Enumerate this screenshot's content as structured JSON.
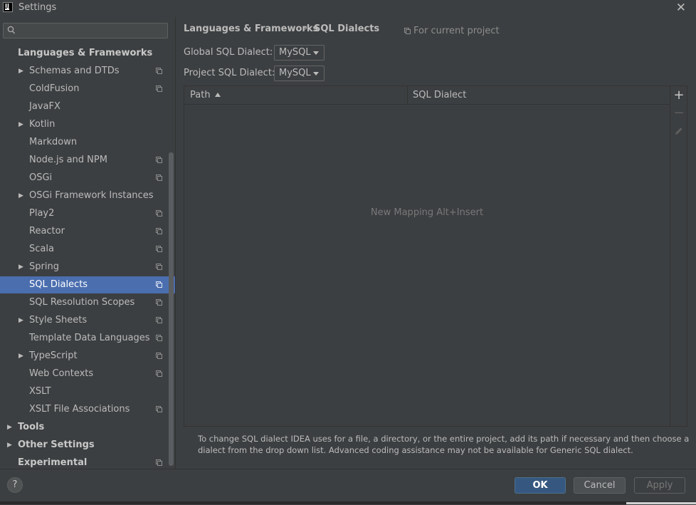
{
  "window": {
    "title": "Settings",
    "close_glyph": "✕",
    "logo_text": "IJ"
  },
  "sidebar": {
    "search_placeholder": "",
    "items": [
      {
        "label": "Languages & Frameworks",
        "level": 0,
        "bold": true,
        "arrow": false,
        "project_icon": false,
        "selected": false
      },
      {
        "label": "Schemas and DTDs",
        "level": 1,
        "bold": false,
        "arrow": true,
        "project_icon": true,
        "selected": false
      },
      {
        "label": "ColdFusion",
        "level": 1,
        "bold": false,
        "arrow": false,
        "project_icon": true,
        "selected": false
      },
      {
        "label": "JavaFX",
        "level": 1,
        "bold": false,
        "arrow": false,
        "project_icon": false,
        "selected": false
      },
      {
        "label": "Kotlin",
        "level": 1,
        "bold": false,
        "arrow": true,
        "project_icon": false,
        "selected": false
      },
      {
        "label": "Markdown",
        "level": 1,
        "bold": false,
        "arrow": false,
        "project_icon": false,
        "selected": false
      },
      {
        "label": "Node.js and NPM",
        "level": 1,
        "bold": false,
        "arrow": false,
        "project_icon": true,
        "selected": false
      },
      {
        "label": "OSGi",
        "level": 1,
        "bold": false,
        "arrow": false,
        "project_icon": true,
        "selected": false
      },
      {
        "label": "OSGi Framework Instances",
        "level": 1,
        "bold": false,
        "arrow": true,
        "project_icon": false,
        "selected": false
      },
      {
        "label": "Play2",
        "level": 1,
        "bold": false,
        "arrow": false,
        "project_icon": true,
        "selected": false
      },
      {
        "label": "Reactor",
        "level": 1,
        "bold": false,
        "arrow": false,
        "project_icon": true,
        "selected": false
      },
      {
        "label": "Scala",
        "level": 1,
        "bold": false,
        "arrow": false,
        "project_icon": true,
        "selected": false
      },
      {
        "label": "Spring",
        "level": 1,
        "bold": false,
        "arrow": true,
        "project_icon": true,
        "selected": false
      },
      {
        "label": "SQL Dialects",
        "level": 1,
        "bold": false,
        "arrow": false,
        "project_icon": true,
        "selected": true
      },
      {
        "label": "SQL Resolution Scopes",
        "level": 1,
        "bold": false,
        "arrow": false,
        "project_icon": true,
        "selected": false
      },
      {
        "label": "Style Sheets",
        "level": 1,
        "bold": false,
        "arrow": true,
        "project_icon": true,
        "selected": false
      },
      {
        "label": "Template Data Languages",
        "level": 1,
        "bold": false,
        "arrow": false,
        "project_icon": true,
        "selected": false
      },
      {
        "label": "TypeScript",
        "level": 1,
        "bold": false,
        "arrow": true,
        "project_icon": true,
        "selected": false
      },
      {
        "label": "Web Contexts",
        "level": 1,
        "bold": false,
        "arrow": false,
        "project_icon": true,
        "selected": false
      },
      {
        "label": "XSLT",
        "level": 1,
        "bold": false,
        "arrow": false,
        "project_icon": false,
        "selected": false
      },
      {
        "label": "XSLT File Associations",
        "level": 1,
        "bold": false,
        "arrow": false,
        "project_icon": true,
        "selected": false
      },
      {
        "label": "Tools",
        "level": 0,
        "bold": true,
        "arrow": true,
        "project_icon": false,
        "selected": false
      },
      {
        "label": "Other Settings",
        "level": 0,
        "bold": true,
        "arrow": true,
        "project_icon": false,
        "selected": false
      },
      {
        "label": "Experimental",
        "level": 0,
        "bold": true,
        "arrow": false,
        "project_icon": true,
        "selected": false
      }
    ]
  },
  "breadcrumb": {
    "parent": "Languages & Frameworks",
    "separator": "›",
    "current": "SQL Dialects",
    "scope_label": "For current project"
  },
  "form": {
    "global_label": "Global SQL Dialect:",
    "global_value": "MySQL",
    "project_label": "Project SQL Dialect:",
    "project_value": "MySQL"
  },
  "table": {
    "columns": [
      "Path",
      "SQL Dialect"
    ],
    "sort_column": "Path",
    "sort_direction": "ascending",
    "rows": [],
    "empty_text": "New Mapping Alt+Insert"
  },
  "toolbar": {
    "add_glyph": "+",
    "remove_glyph": "−"
  },
  "help_text": "To change SQL dialect IDEA uses for a file, a directory, or the entire project, add its path if necessary and then choose a dialect from the drop down list. Advanced coding assistance may not be available for Generic SQL dialect.",
  "footer": {
    "help_glyph": "?",
    "ok": "OK",
    "cancel": "Cancel",
    "apply": "Apply"
  },
  "colors": {
    "selection": "#4b6eaf",
    "ok_button": "#365880",
    "background": "#3c3f41"
  }
}
